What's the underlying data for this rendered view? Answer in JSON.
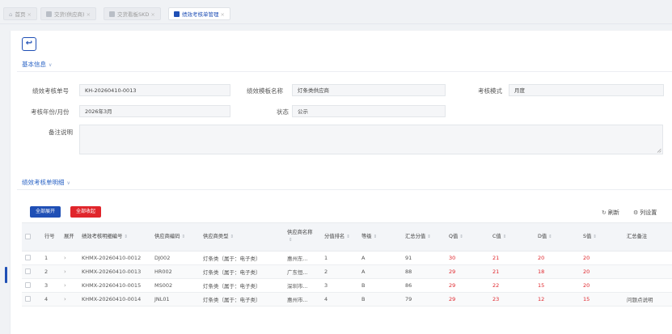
{
  "tabs": [
    {
      "label": "首页",
      "icon": "home-icon",
      "close": "×"
    },
    {
      "label": "交货(供应商)",
      "icon": "document-icon",
      "close": "×"
    },
    {
      "label": "交货看板SKD",
      "icon": "board-icon",
      "close": "×"
    },
    {
      "label": "绩效考核单管理",
      "icon": "form-icon",
      "close": "×",
      "active": true
    }
  ],
  "back_button": {
    "icon": "back-arrow-icon",
    "glyph": "↩"
  },
  "basic_info": {
    "title": "基本信息",
    "fields": {
      "code_label": "绩效考核单号",
      "code_value": "KH-20260410-0013",
      "template_label": "绩效模板名称",
      "template_value": "灯条类供应商",
      "mode_label": "考核模式",
      "mode_value": "月度",
      "period_label": "考核年份/月份",
      "period_value": "2026年3月",
      "status_label": "状态",
      "status_value": "公示",
      "remark_label": "备注说明",
      "remark_value": ""
    }
  },
  "detail": {
    "title": "绩效考核单明细",
    "expand_all": "全部展开",
    "collapse_all": "全部收起",
    "refresh": "刷新",
    "column_settings": "列设置",
    "columns": [
      "",
      "行号",
      "展开",
      "绩效考核明细编号",
      "供应商编码",
      "供应商类型",
      "供应商名称",
      "分值排名",
      "等级",
      "汇总分值",
      "Q值",
      "C值",
      "D值",
      "S值",
      "汇总备注"
    ],
    "rows": [
      {
        "no": "1",
        "expand": "›",
        "code": "KHMX-20260410-0012",
        "supplier_code": "DJ002",
        "supplier_type": "灯条类（属于：电子类）",
        "supplier_name": "惠州东...",
        "rank": "1",
        "grade": "A",
        "total": "91",
        "q": "30",
        "c": "21",
        "d": "20",
        "s": "20",
        "remark": ""
      },
      {
        "no": "2",
        "expand": "›",
        "code": "KHMX-20260410-0013",
        "supplier_code": "HR002",
        "supplier_type": "灯条类（属于：电子类）",
        "supplier_name": "广东恒...",
        "rank": "2",
        "grade": "A",
        "total": "88",
        "q": "29",
        "c": "21",
        "d": "18",
        "s": "20",
        "remark": ""
      },
      {
        "no": "3",
        "expand": "›",
        "code": "KHMX-20260410-0015",
        "supplier_code": "MS002",
        "supplier_type": "灯条类（属于：电子类）",
        "supplier_name": "深圳市...",
        "rank": "3",
        "grade": "B",
        "total": "86",
        "q": "29",
        "c": "22",
        "d": "15",
        "s": "20",
        "remark": ""
      },
      {
        "no": "4",
        "expand": "›",
        "code": "KHMX-20260410-0014",
        "supplier_code": "JNL01",
        "supplier_type": "灯条类（属于：电子类）",
        "supplier_name": "惠州市...",
        "rank": "4",
        "grade": "B",
        "total": "79",
        "q": "29",
        "c": "23",
        "d": "12",
        "s": "15",
        "remark": "问题点说明"
      }
    ]
  },
  "colors": {
    "primary": "#1f4fb5",
    "danger": "#e0252b",
    "section_title": "#2a63c5"
  }
}
